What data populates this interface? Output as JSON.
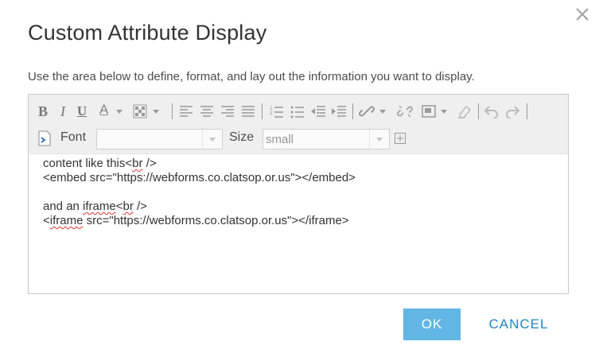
{
  "dialog": {
    "title": "Custom Attribute Display",
    "instructions": "Use the area below to define, format, and lay out the information you want to display."
  },
  "toolbar": {
    "bold": "B",
    "italic": "I",
    "underline": "U",
    "font_color": "A",
    "font_label": "Font",
    "font_value": "",
    "size_label": "Size",
    "size_value": "small"
  },
  "content": {
    "lines": [
      [
        "content like this<",
        "br",
        " />"
      ],
      [
        "<embed src=\"https://webforms.co.clatsop.or.us\"></embed>"
      ],
      [
        ""
      ],
      [
        "and an ",
        "iframe",
        "<",
        "br",
        " />"
      ],
      [
        "<",
        "iframe",
        " src=\"https://webforms.co.clatsop.or.us\"></iframe>"
      ]
    ]
  },
  "buttons": {
    "ok": "OK",
    "cancel": "CANCEL"
  },
  "colors": {
    "ok_background": "#62b6e3",
    "cancel_text": "#1f87c3",
    "spellcheck": "#dd3333"
  },
  "icons": [
    "close-icon",
    "font-color-icon",
    "highlight-color-icon",
    "align-left-icon",
    "align-center-icon",
    "align-right-icon",
    "justify-icon",
    "ordered-list-icon",
    "unordered-list-icon",
    "outdent-icon",
    "indent-icon",
    "link-icon",
    "unlink-icon",
    "insert-image-icon",
    "clear-format-icon",
    "undo-icon",
    "redo-icon",
    "view-source-icon",
    "fullscreen-icon"
  ]
}
